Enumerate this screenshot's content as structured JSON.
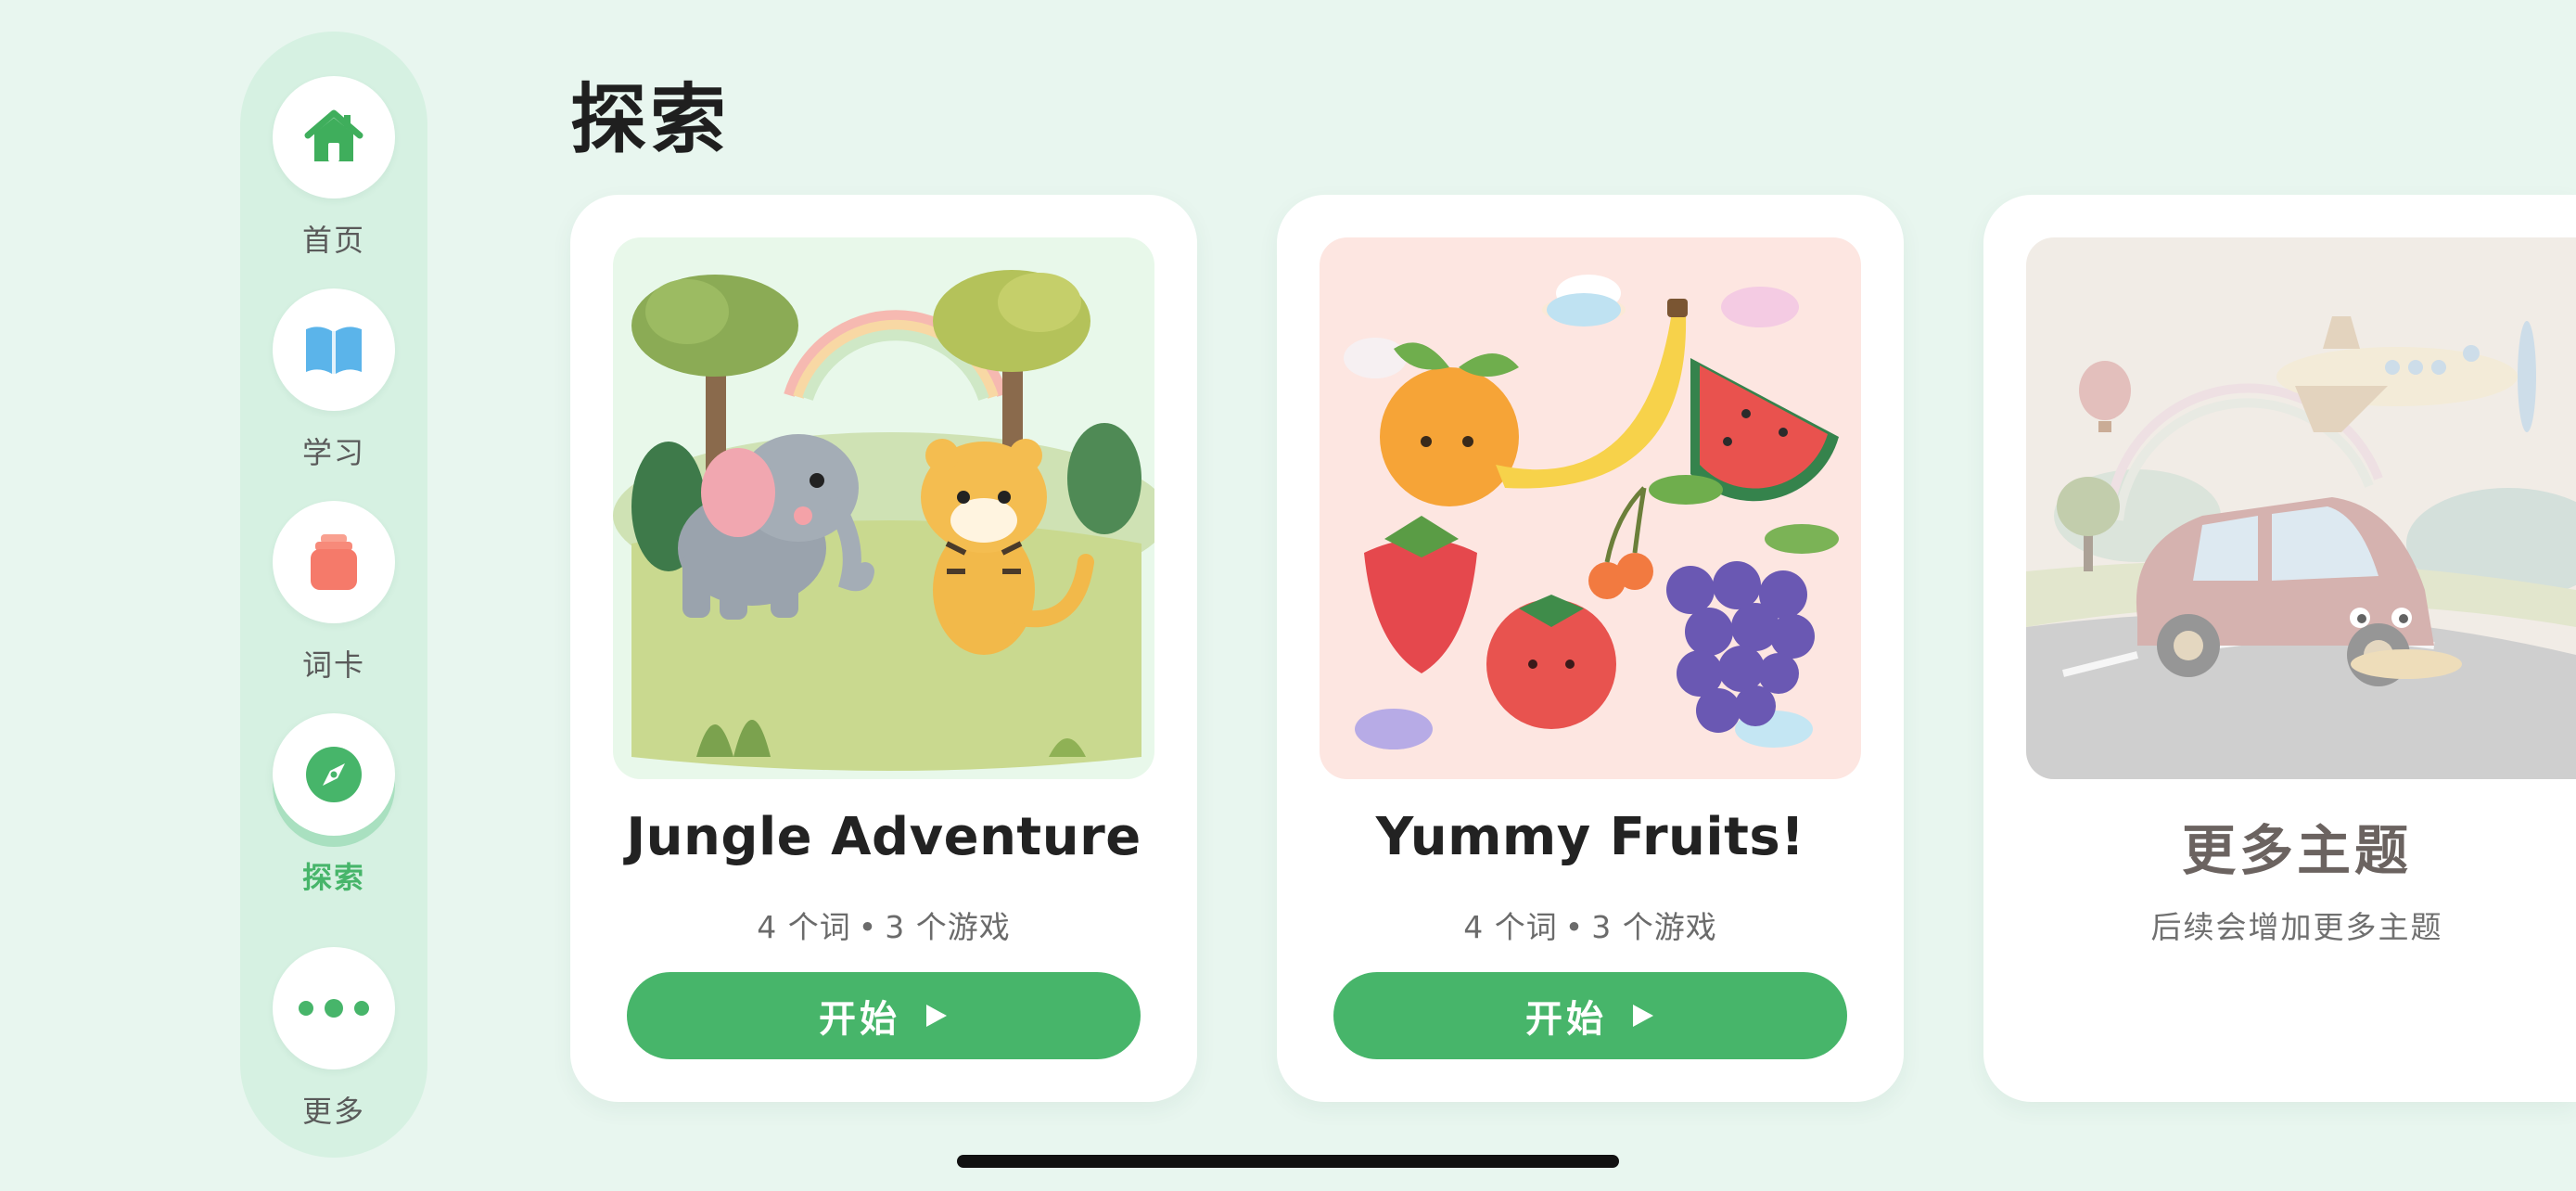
{
  "sidebar": {
    "items": [
      {
        "label": "首页",
        "icon": "home-icon",
        "color": "#3fae5c"
      },
      {
        "label": "学习",
        "icon": "book-icon",
        "color": "#5bb4ea"
      },
      {
        "label": "词卡",
        "icon": "cards-icon",
        "color": "#f57a6a"
      },
      {
        "label": "探索",
        "icon": "compass-icon",
        "color": "#47b56a",
        "active": true
      },
      {
        "label": "更多",
        "icon": "more-dots-icon",
        "color": "#47b56a"
      }
    ]
  },
  "page": {
    "title": "探索"
  },
  "cards": [
    {
      "title": "Jungle Adventure",
      "words": "4 个词",
      "separator": "•",
      "games": "3 个游戏",
      "button_label": "开始",
      "image": "jungle-elephant-tiger-illustration"
    },
    {
      "title": "Yummy Fruits!",
      "words": "4 个词",
      "separator": "•",
      "games": "3 个游戏",
      "button_label": "开始",
      "image": "fruits-illustration"
    }
  ],
  "more_card": {
    "title": "更多主题",
    "subtitle": "后续会增加更多主题",
    "image": "car-plane-illustration"
  },
  "colors": {
    "background": "#e8f6ef",
    "sidebar": "#d6f1e2",
    "accent": "#47b56a"
  }
}
